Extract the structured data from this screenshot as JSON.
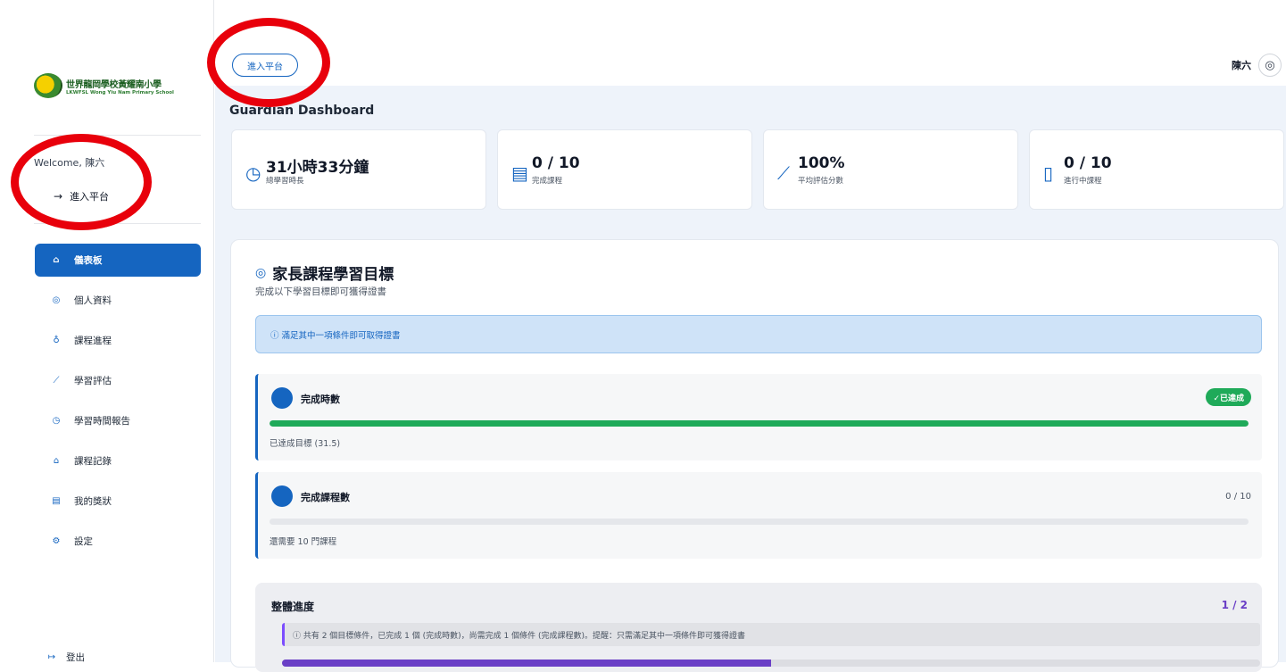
{
  "school": {
    "name_zh": "世界龍岡學校黃耀南小學",
    "name_en": "LKWFSL Wong Yiu Nam Primary School"
  },
  "sidebar": {
    "welcome": "Welcome, 陳六",
    "enter_platform": "進入平台",
    "nav": [
      {
        "label": "儀表板",
        "icon": "home-icon",
        "active": true
      },
      {
        "label": "個人資料",
        "icon": "user-circle-icon"
      },
      {
        "label": "課程進程",
        "icon": "medal-icon"
      },
      {
        "label": "學習評估",
        "icon": "line-chart-icon"
      },
      {
        "label": "學習時間報告",
        "icon": "clock-icon"
      },
      {
        "label": "課程記錄",
        "icon": "graduation-cap-icon"
      },
      {
        "label": "我的獎狀",
        "icon": "certificate-icon"
      },
      {
        "label": "設定",
        "icon": "gear-icon"
      }
    ],
    "logout": "登出"
  },
  "topbar": {
    "enter_button": "進入平台",
    "user_name": "陳六"
  },
  "dashboard": {
    "title": "Guardian Dashboard",
    "stats": [
      {
        "value": "31小時33分鐘",
        "label": "總學習時長",
        "icon": "clock-icon"
      },
      {
        "value": "0 / 10",
        "label": "完成課程",
        "icon": "certificate-icon"
      },
      {
        "value": "100%",
        "label": "平均評估分數",
        "icon": "line-chart-icon"
      },
      {
        "value": "0 / 10",
        "label": "進行中課程",
        "icon": "book-icon"
      }
    ]
  },
  "goals": {
    "title": "家長課程學習目標",
    "subtitle": "完成以下學習目標即可獲得證書",
    "notice": "ⓘ 滿足其中一項條件即可取得證書",
    "conditions": [
      {
        "name": "完成時數",
        "badge": "✓已達成",
        "progress": 1.0,
        "note": "已達成目標 (31.5)",
        "color": "#1faa59"
      },
      {
        "name": "完成課程數",
        "count": "0 / 10",
        "progress": 0.0,
        "note": "還需要 10 門課程",
        "color": "#1faa59"
      }
    ],
    "overall": {
      "title": "整體進度",
      "fraction": "1 / 2",
      "message": "ⓘ 共有 2 個目標條件，已完成 1 個 (完成時數)，尚需完成 1 個條件 (完成課程數)。提醒：只需滿足其中一項條件即可獲得證書",
      "progress": 0.5
    }
  },
  "colors": {
    "primary": "#1565c0",
    "success": "#1faa59",
    "purple": "#6a3fc6",
    "highlight_ring": "#e8000b"
  }
}
